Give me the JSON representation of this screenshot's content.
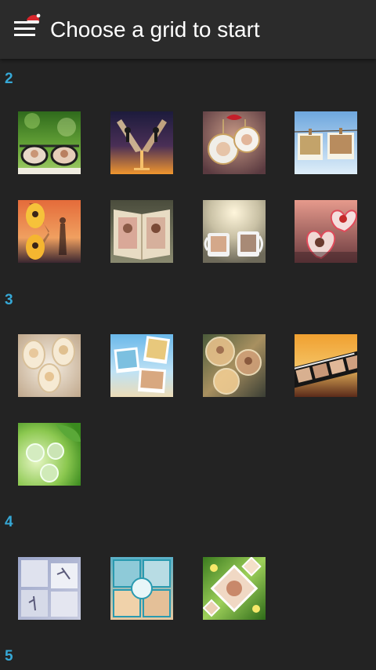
{
  "appbar": {
    "title": "Choose a grid to start",
    "menu_icon": "hamburger-menu-icon",
    "hat_icon": "santa-hat-icon"
  },
  "colors": {
    "background": "#232323",
    "appbar": "#2b2b2b",
    "section_label": "#36a8d6",
    "title_text": "#ffffff"
  },
  "sections": [
    {
      "label": "2",
      "templates": [
        {
          "name": "glasses-lenses-collage"
        },
        {
          "name": "champagne-glasses-collage"
        },
        {
          "name": "christmas-ornaments-collage"
        },
        {
          "name": "hanging-polaroids-collage"
        },
        {
          "name": "hourglass-sunset-collage"
        },
        {
          "name": "open-book-collage"
        },
        {
          "name": "coffee-mugs-collage"
        },
        {
          "name": "hearts-collage"
        }
      ]
    },
    {
      "label": "3",
      "templates": [
        {
          "name": "oval-frames-collage"
        },
        {
          "name": "beach-polaroids-collage"
        },
        {
          "name": "bubbles-collage"
        },
        {
          "name": "film-strip-sunset-collage"
        },
        {
          "name": "water-drops-leaf-collage"
        }
      ]
    },
    {
      "label": "4",
      "templates": [
        {
          "name": "dancer-squares-collage"
        },
        {
          "name": "perfect-you-collage"
        },
        {
          "name": "diamond-flowers-collage"
        }
      ]
    },
    {
      "label": "5",
      "templates": []
    }
  ]
}
